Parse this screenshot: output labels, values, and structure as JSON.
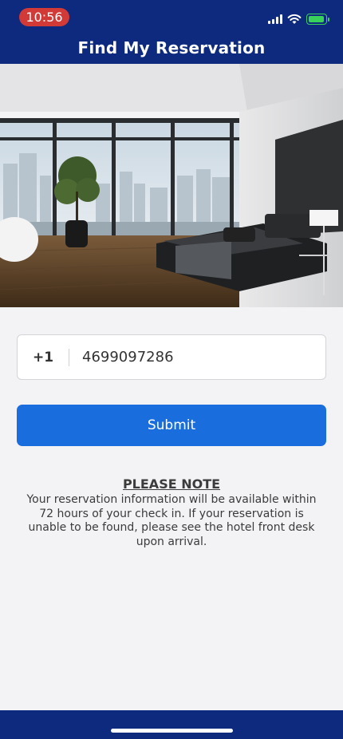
{
  "status_bar": {
    "time": "10:56"
  },
  "header": {
    "title": "Find My Reservation"
  },
  "hero": {
    "description_icon": "hotel-room-image"
  },
  "form": {
    "country_code": "+1",
    "phone_value": "4699097286",
    "submit_label": "Submit"
  },
  "note": {
    "title": "PLEASE NOTE",
    "body": "Your reservation information will be available within 72 hours of your check in.  If your reservation is unable to be found, please see the hotel front desk upon arrival."
  },
  "colors": {
    "header_bg": "#0d2a7e",
    "button_bg": "#1a6ddc",
    "time_pill": "#d23a37",
    "battery": "#38d15a"
  }
}
